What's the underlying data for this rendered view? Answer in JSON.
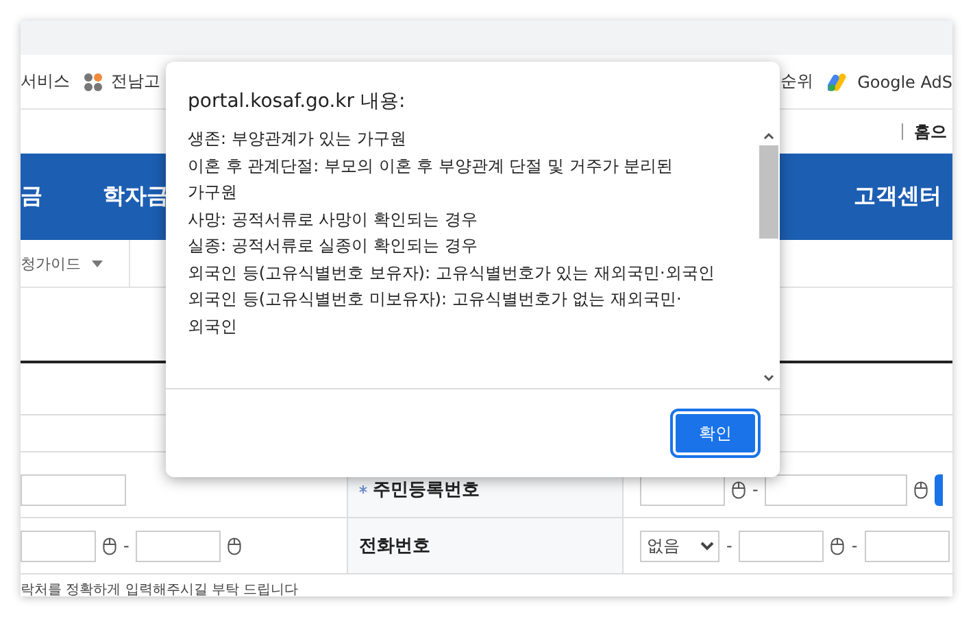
{
  "bookmarks_left": [
    {
      "kind": "text",
      "label": "서비스"
    },
    {
      "kind": "apps",
      "label": "전남고"
    }
  ],
  "bookmarks_right": [
    {
      "kind": "text",
      "label": "순위"
    },
    {
      "kind": "ads",
      "label": "Google AdS"
    }
  ],
  "utility_links": [
    "홈으"
  ],
  "nav_left": [
    "금",
    "학자금"
  ],
  "nav_right": [
    "고객센터"
  ],
  "subnav": {
    "label": "청가이드"
  },
  "form": {
    "separator": "-",
    "rows": [
      {
        "kind": "id",
        "label": "주민등록번호",
        "required": true
      },
      {
        "kind": "phone",
        "label": "전화번호",
        "required": false,
        "select": "없음"
      }
    ],
    "note": "락처를 정확하게 입력해주시길 부탁 드립니다"
  },
  "dialog": {
    "title": "portal.kosaf.go.kr 내용:",
    "lines": [
      "생존: 부양관계가 있는 가구원",
      "이혼 후 관계단절: 부모의 이혼 후 부양관계 단절 및 거주가 분리된 가구원",
      "사망: 공적서류로 사망이 확인되는 경우",
      "실종: 공적서류로 실종이 확인되는 경우",
      "외국인 등(고유식별번호 보유자): 고유식별번호가 있는 재외국민·외국인",
      "외국인 등(고유식별번호 미보유자): 고유식별번호가 없는 재외국민·외국인"
    ],
    "button": "확인"
  }
}
